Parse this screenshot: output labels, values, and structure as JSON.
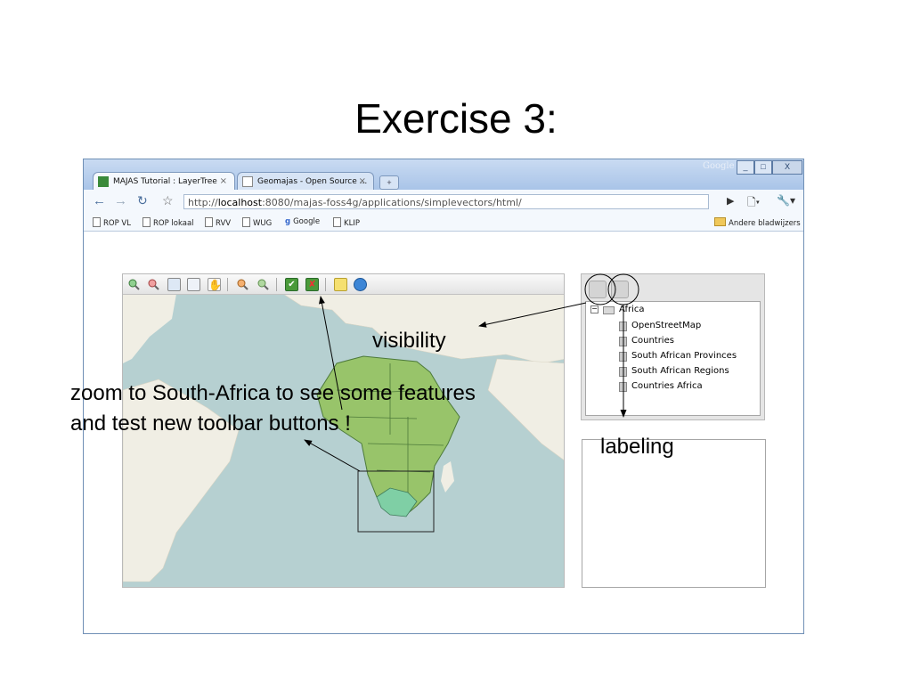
{
  "slide": {
    "title": "Exercise 3:"
  },
  "browser": {
    "tabs": [
      {
        "label": "MAJAS Tutorial : LayerTree",
        "close": "×"
      },
      {
        "label": "Geomajas - Open Source ...",
        "close": "×"
      }
    ],
    "new_tab": "+",
    "brand": "Google",
    "window_buttons": [
      "_",
      "□",
      "X"
    ],
    "url_prefix": "http://",
    "url_host": "localhost",
    "url_rest": ":8080/majas-foss4g/applications/simplevectors/html/",
    "bookmarks": [
      "ROP VL",
      "ROP lokaal",
      "RVV",
      "WUG",
      "Google",
      "KLIP"
    ],
    "other_bookmarks": "Andere bladwijzers"
  },
  "layer_tree": {
    "root": "Africa",
    "layers": [
      "OpenStreetMap",
      "Countries",
      "South African Provinces",
      "South African Regions",
      "Countries Africa"
    ]
  },
  "annotations": {
    "visibility": "visibility",
    "labeling": "labeling",
    "zoom_line1": "zoom to South-Africa to see some features",
    "zoom_line2": "and test new toolbar buttons !"
  },
  "colors": {
    "water": "#b6d0d1",
    "land": "#f0eee4",
    "africa": "#98c46a",
    "south_africa": "#7fcfa5"
  },
  "icons": [
    "zoom-in-icon",
    "zoom-out-icon",
    "zoom-rectangle-icon",
    "zoom-extent-icon",
    "pan-hand-icon",
    "zoom-previous-icon",
    "zoom-next-icon",
    "select-icon",
    "deselect-icon",
    "measure-icon",
    "info-globe-icon",
    "visibility-toggle-icon",
    "labeling-toggle-icon"
  ]
}
